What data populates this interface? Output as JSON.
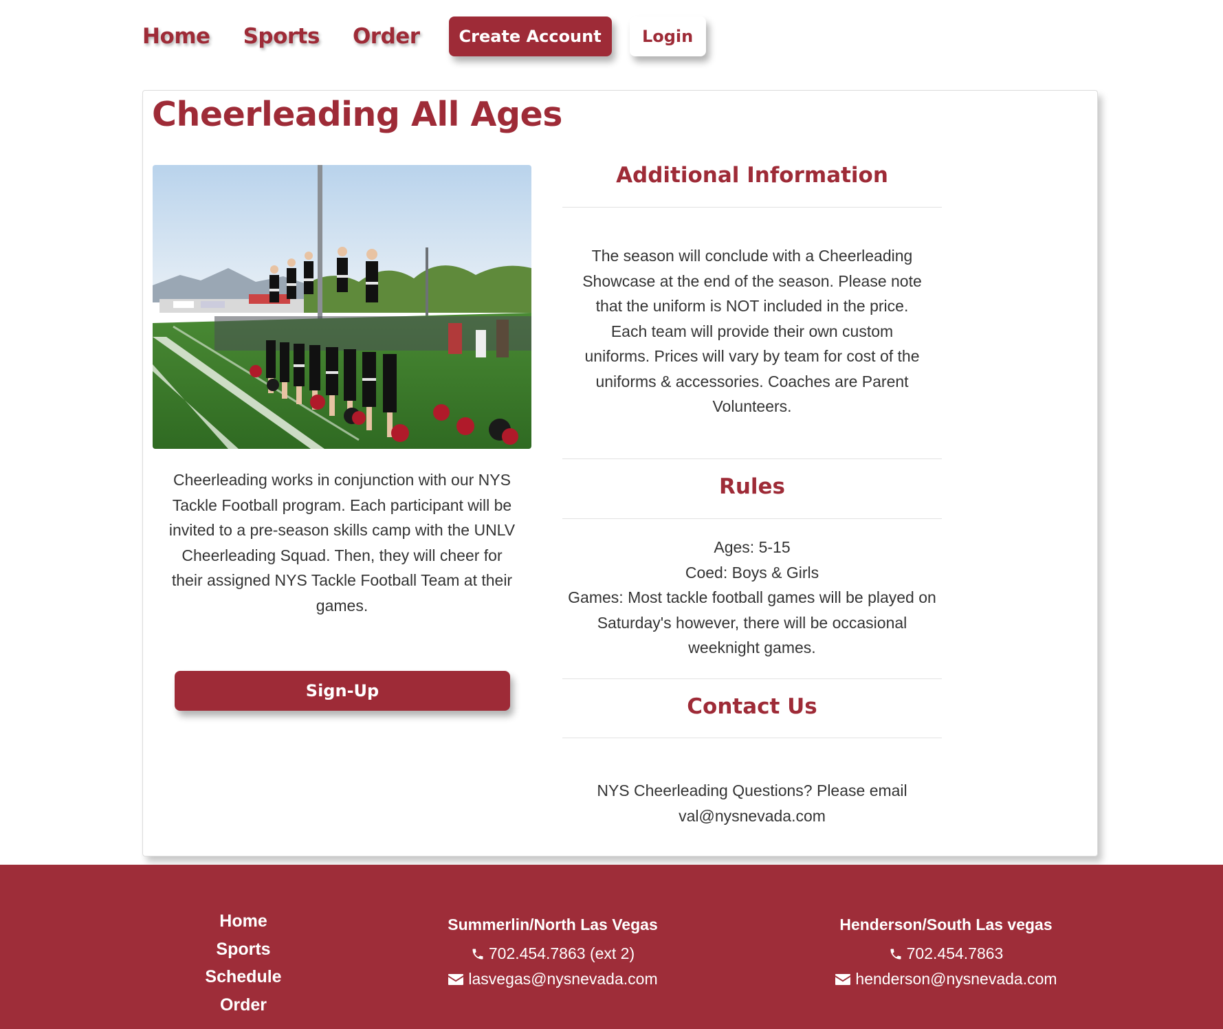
{
  "nav": {
    "home": "Home",
    "sports": "Sports",
    "order": "Order",
    "create_account": "Create Account",
    "login": "Login"
  },
  "page": {
    "title": "Cheerleading All Ages",
    "image_alt": "Cheerleaders performing on a football field sideline",
    "description": "Cheerleading works in conjunction with our NYS Tackle Football program. Each participant will be invited to a pre-season skills camp with the UNLV Cheerleading Squad. Then, they will cheer for their assigned NYS Tackle Football Team at their games.",
    "signup_label": "Sign-Up"
  },
  "additional_info": {
    "heading": "Additional Information",
    "text": "The season will conclude with a Cheerleading Showcase at the end of the season. Please note that the uniform is NOT included in the price. Each team will provide their own custom uniforms. Prices will vary by team for cost of the uniforms & accessories. Coaches are Parent Volunteers."
  },
  "rules": {
    "heading": "Rules",
    "ages": "Ages: 5-15",
    "coed": "Coed: Boys & Girls",
    "games": "Games: Most tackle football games will be played on Saturday's however, there will be occasional weeknight games."
  },
  "contact": {
    "heading": "Contact Us",
    "line1": "NYS Cheerleading Questions? Please email",
    "email": "val@nysnevada.com"
  },
  "footer": {
    "links": [
      "Home",
      "Sports",
      "Schedule",
      "Order"
    ],
    "locations": [
      {
        "title": "Summerlin/North Las Vegas",
        "phone": "702.454.7863 (ext 2)",
        "email": "lasvegas@nysnevada.com"
      },
      {
        "title": "Henderson/South Las vegas",
        "phone": "702.454.7863",
        "email": "henderson@nysnevada.com"
      }
    ]
  },
  "colors": {
    "brand": "#9e2b37",
    "footer_bg": "#9e2d39",
    "text": "#333333"
  },
  "icons": {
    "phone": "phone-icon",
    "email": "envelope-icon"
  }
}
